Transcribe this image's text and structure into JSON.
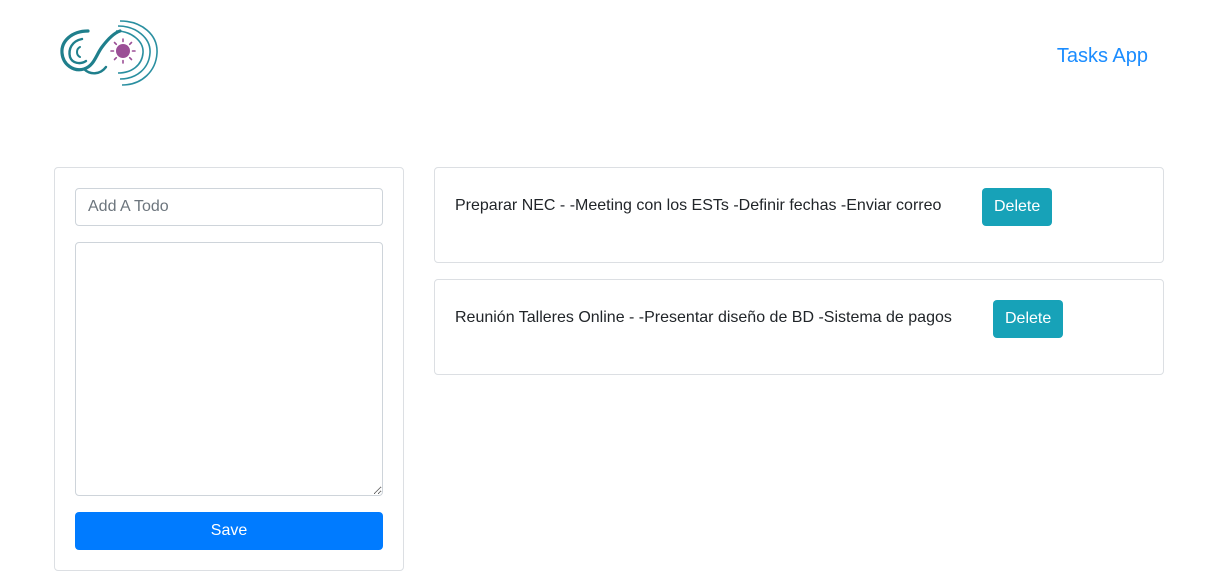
{
  "navbar": {
    "logo_icon": "spiral-sun-logo",
    "brand": "Tasks App"
  },
  "form": {
    "title_placeholder": "Add A Todo",
    "description_value": "",
    "save_label": "Save"
  },
  "todos": [
    {
      "text": "Preparar NEC - -Meeting con los ESTs -Definir fechas -Enviar correo",
      "delete_label": "Delete"
    },
    {
      "text": "Reunión Talleres Online - -Presentar diseño de BD -Sistema de pagos",
      "delete_label": "Delete"
    }
  ],
  "colors": {
    "brand_link": "#1a8cff",
    "primary": "#007bff",
    "info": "#17a2b8",
    "logo_teal": "#1f7f8c",
    "logo_purple": "#9b4f96"
  }
}
